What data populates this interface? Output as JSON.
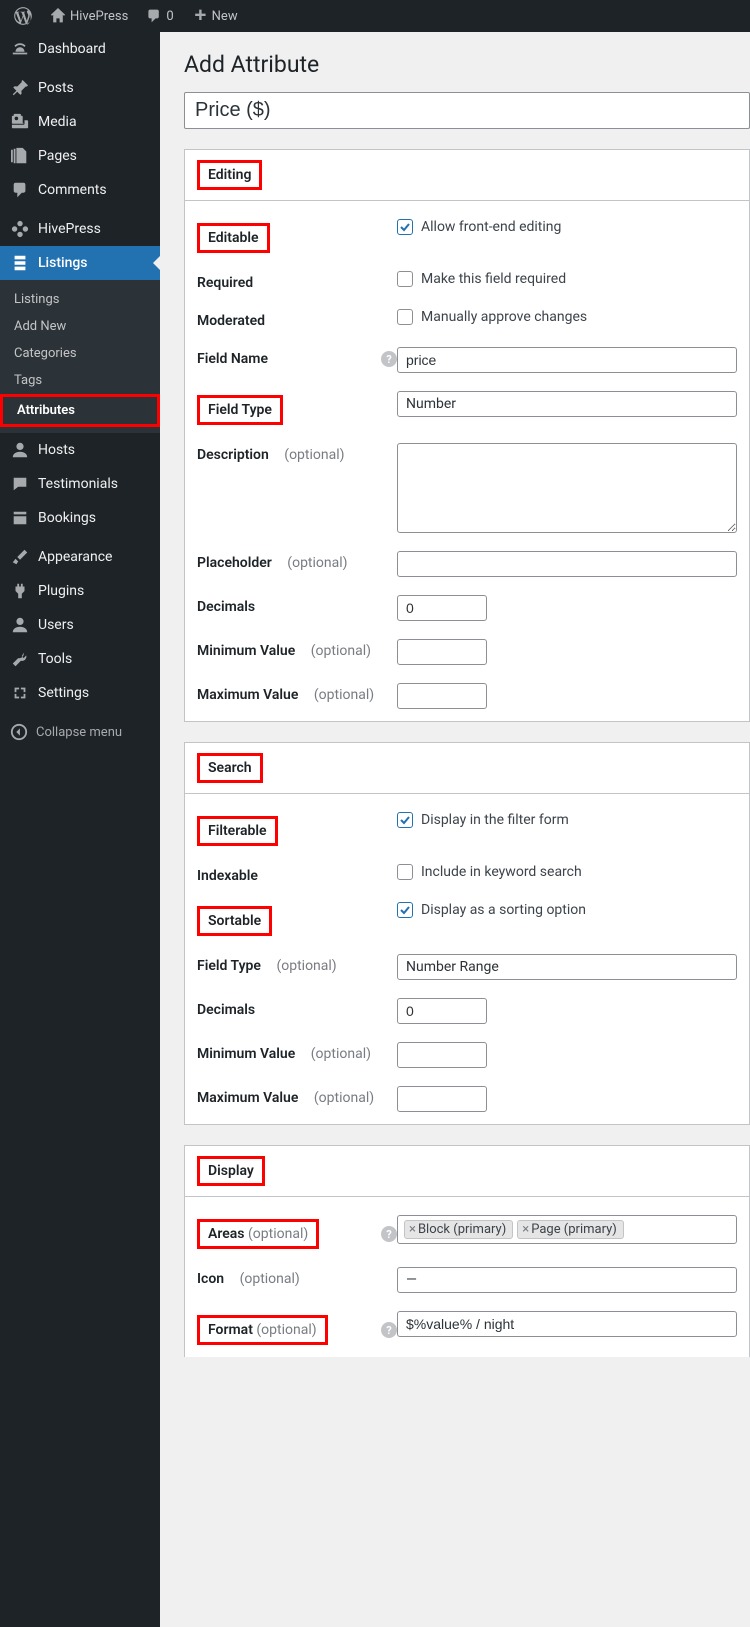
{
  "adminbar": {
    "site_name": "HivePress",
    "comments_count": "0",
    "new_label": "New"
  },
  "sidebar": {
    "dashboard": "Dashboard",
    "posts": "Posts",
    "media": "Media",
    "pages": "Pages",
    "comments": "Comments",
    "hivepress": "HivePress",
    "listings": "Listings",
    "sub_listings": "Listings",
    "sub_add_new": "Add New",
    "sub_categories": "Categories",
    "sub_tags": "Tags",
    "sub_attributes": "Attributes",
    "hosts": "Hosts",
    "testimonials": "Testimonials",
    "bookings": "Bookings",
    "appearance": "Appearance",
    "plugins": "Plugins",
    "users": "Users",
    "tools": "Tools",
    "settings": "Settings",
    "collapse": "Collapse menu"
  },
  "page": {
    "title": "Add Attribute",
    "title_input": "Price ($)"
  },
  "editing": {
    "section_title": "Editing",
    "editable_label": "Editable",
    "editable_checkbox": "Allow front-end editing",
    "required_label": "Required",
    "required_checkbox": "Make this field required",
    "moderated_label": "Moderated",
    "moderated_checkbox": "Manually approve changes",
    "field_name_label": "Field Name",
    "field_name_value": "price",
    "field_type_label": "Field Type",
    "field_type_value": "Number",
    "description_label": "Description",
    "optional": "(optional)",
    "placeholder_label": "Placeholder",
    "decimals_label": "Decimals",
    "decimals_value": "0",
    "min_label": "Minimum Value",
    "max_label": "Maximum Value"
  },
  "search": {
    "section_title": "Search",
    "filterable_label": "Filterable",
    "filterable_checkbox": "Display in the filter form",
    "indexable_label": "Indexable",
    "indexable_checkbox": "Include in keyword search",
    "sortable_label": "Sortable",
    "sortable_checkbox": "Display as a sorting option",
    "field_type_label": "Field Type",
    "field_type_value": "Number Range",
    "decimals_label": "Decimals",
    "decimals_value": "0",
    "min_label": "Minimum Value",
    "max_label": "Maximum Value",
    "optional": "(optional)"
  },
  "display": {
    "section_title": "Display",
    "areas_label": "Areas",
    "areas_tags": [
      "Block (primary)",
      "Page (primary)"
    ],
    "icon_label": "Icon",
    "icon_value": "—",
    "format_label": "Format",
    "format_value": "$%value% / night",
    "optional": "(optional)"
  }
}
